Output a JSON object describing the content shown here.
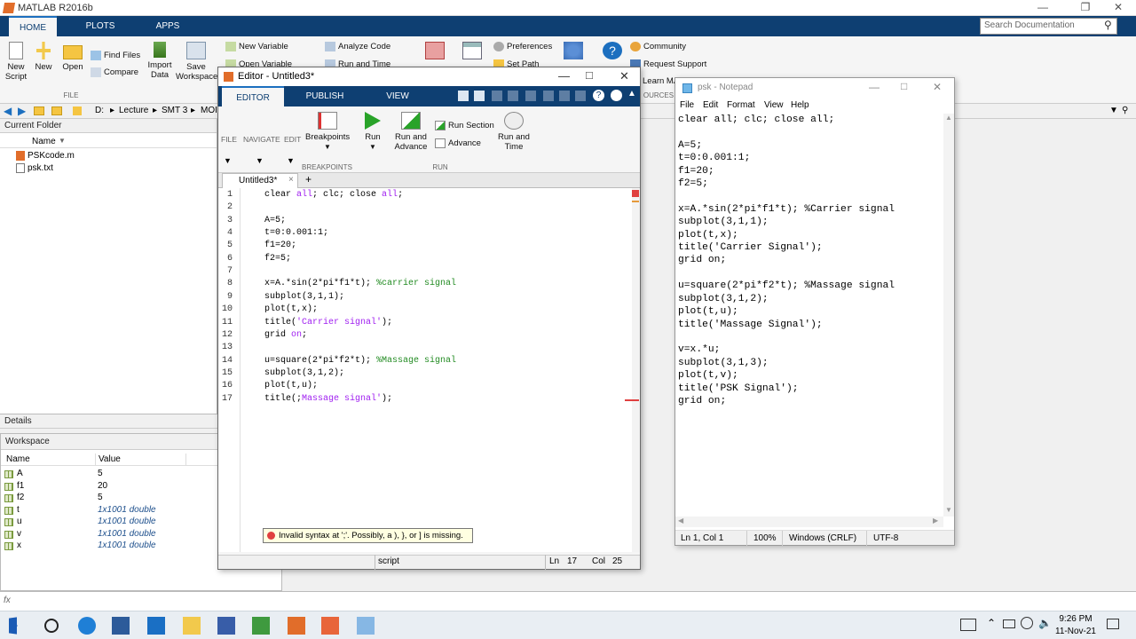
{
  "matlab": {
    "title": "MATLAB R2016b",
    "tabs": [
      "HOME",
      "PLOTS",
      "APPS"
    ],
    "search_placeholder": "Search Documentation",
    "ribbon": {
      "new_script": "New\nScript",
      "new": "New",
      "open": "Open",
      "find_files": "Find Files",
      "compare": "Compare",
      "import_data": "Import\nData",
      "save_workspace": "Save\nWorkspace",
      "new_variable": "New Variable",
      "open_variable": "Open Variable",
      "analyze_code": "Analyze Code",
      "run_and_time": "Run and Time",
      "preferences": "Preferences",
      "set_path": "Set Path",
      "community": "Community",
      "request_support": "Request Support",
      "learn_matlab": "Learn MA",
      "file_group": "FILE",
      "resources_group": "OURCES"
    },
    "address": [
      "D:",
      "Lecture",
      "SMT 3",
      "MOI"
    ],
    "current_folder": {
      "title": "Current Folder",
      "name_header": "Name",
      "files": [
        "PSKcode.m",
        "psk.txt"
      ]
    },
    "details_title": "Details",
    "workspace": {
      "title": "Workspace",
      "headers": [
        "Name",
        "Value"
      ],
      "rows": [
        {
          "name": "A",
          "value": "5",
          "italic": false
        },
        {
          "name": "f1",
          "value": "20",
          "italic": false
        },
        {
          "name": "f2",
          "value": "5",
          "italic": false
        },
        {
          "name": "t",
          "value": "1x1001 double",
          "italic": true
        },
        {
          "name": "u",
          "value": "1x1001 double",
          "italic": true
        },
        {
          "name": "v",
          "value": "1x1001 double",
          "italic": true
        },
        {
          "name": "x",
          "value": "1x1001 double",
          "italic": true
        }
      ]
    },
    "command_prompt": "fx"
  },
  "editor": {
    "title": "Editor - Untitled3*",
    "tabs": [
      "EDITOR",
      "PUBLISH",
      "VIEW"
    ],
    "toolbar": {
      "file": "FILE",
      "navigate": "NAVIGATE",
      "edit": "EDIT",
      "breakpoints": "Breakpoints",
      "breakpoints_group": "BREAKPOINTS",
      "run": "Run",
      "run_and_advance": "Run and\nAdvance",
      "run_section": "Run Section",
      "advance": "Advance",
      "run_and_time": "Run and\nTime",
      "run_group": "RUN"
    },
    "file_tab": "Untitled3*",
    "add_tab": "+",
    "code_lines": [
      "clear all; clc; close all;",
      "",
      "A=5;",
      "t=0:0.001:1;",
      "f1=20;",
      "f2=5;",
      "",
      "x=A.*sin(2*pi*f1*t); %carrier signal",
      "subplot(3,1,1);",
      "plot(t,x);",
      "title('Carrier signal');",
      "grid on;",
      "",
      "u=square(2*pi*f2*t); %Massage signal",
      "subplot(3,1,2);",
      "plot(t,u);",
      "title(;Massage signal');"
    ],
    "tooltip": "Invalid syntax at ';'. Possibly, a ), }, or ] is missing.",
    "status": {
      "mode": "script",
      "ln_label": "Ln",
      "ln": "17",
      "col_label": "Col",
      "col": "25"
    }
  },
  "notepad": {
    "title": "psk - Notepad",
    "menu": [
      "File",
      "Edit",
      "Format",
      "View",
      "Help"
    ],
    "text": "clear all; clc; close all;\n\nA=5;\nt=0:0.001:1;\nf1=20;\nf2=5;\n\nx=A.*sin(2*pi*f1*t); %Carrier signal\nsubplot(3,1,1);\nplot(t,x);\ntitle('Carrier Signal');\ngrid on;\n\nu=square(2*pi*f2*t); %Massage signal\nsubplot(3,1,2);\nplot(t,u);\ntitle('Massage Signal');\n\nv=x.*u;\nsubplot(3,1,3);\nplot(t,v);\ntitle('PSK Signal');\ngrid on;",
    "status": {
      "pos": "Ln 1, Col 1",
      "zoom": "100%",
      "eol": "Windows (CRLF)",
      "enc": "UTF-8"
    }
  },
  "taskbar": {
    "time": "9:26 PM",
    "date": "11-Nov-21"
  }
}
